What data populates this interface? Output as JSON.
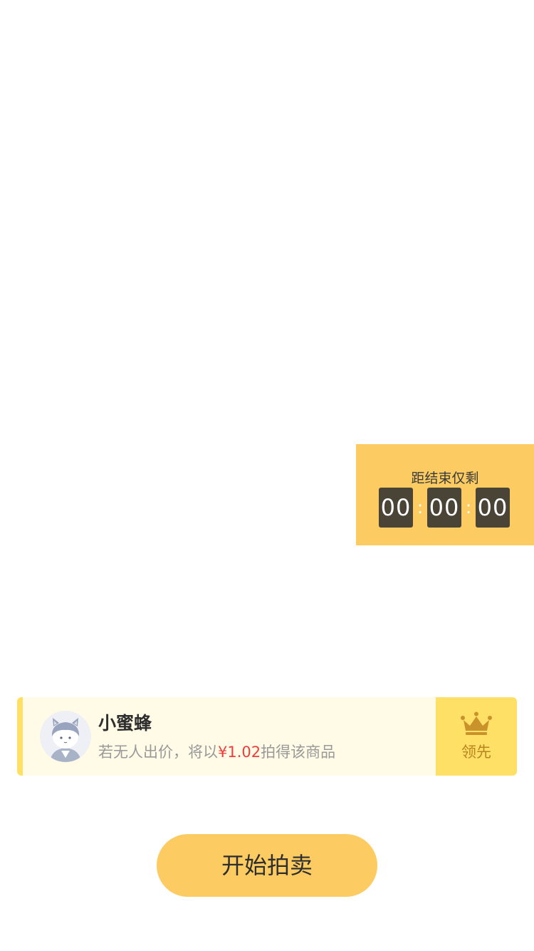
{
  "countdown": {
    "label": "距结束仅剩",
    "hours": "00",
    "minutes": "00",
    "seconds": "00",
    "separator": ":"
  },
  "bidder": {
    "name": "小蜜蜂",
    "note_prefix": "若无人出价，将以",
    "price": "¥1.02",
    "note_suffix": "拍得该商品",
    "badge_icon": "crown-icon",
    "badge_label": "领先"
  },
  "start_button": {
    "label": "开始拍卖"
  },
  "colors": {
    "accent_yellow": "#fccb61",
    "card_background": "#fffbe6",
    "badge_yellow": "#ffe066",
    "price_red": "#f03c3c",
    "digit_background": "#4a4436"
  }
}
